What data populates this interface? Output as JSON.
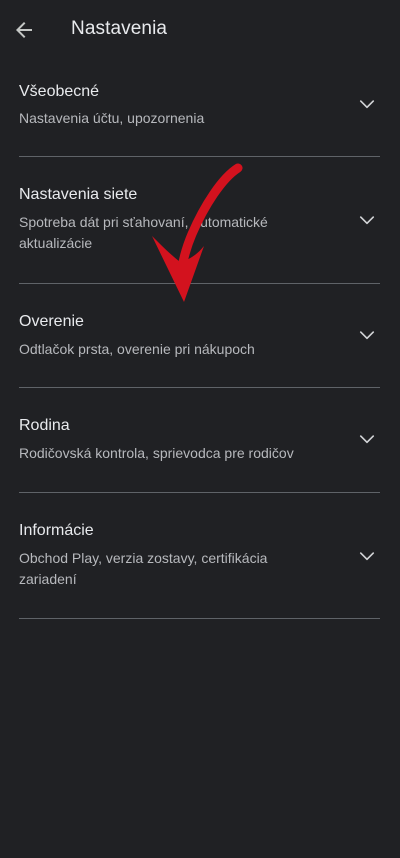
{
  "header": {
    "title": "Nastavenia",
    "back_icon": "arrow-back-icon"
  },
  "sections": [
    {
      "title": "Všeobecné",
      "subtitle": "Nastavenia účtu, upozornenia",
      "icon": "chevron-down-icon"
    },
    {
      "title": "Nastavenia siete",
      "subtitle": "Spotreba dát pri sťahovaní, automatické aktualizácie",
      "icon": "chevron-down-icon"
    },
    {
      "title": "Overenie",
      "subtitle": "Odtlačok prsta, overenie pri nákupoch",
      "icon": "chevron-down-icon"
    },
    {
      "title": "Rodina",
      "subtitle": "Rodičovská kontrola, sprievodca pre rodičov",
      "icon": "chevron-down-icon"
    },
    {
      "title": "Informácie",
      "subtitle": "Obchod Play, verzia zostavy, certifikácia zariadení",
      "icon": "chevron-down-icon"
    }
  ],
  "colors": {
    "background": "#202124",
    "text_primary": "#e8eaed",
    "text_secondary": "#b7b9bd",
    "divider": "#5f6368",
    "annotation_arrow": "#d3121e"
  }
}
